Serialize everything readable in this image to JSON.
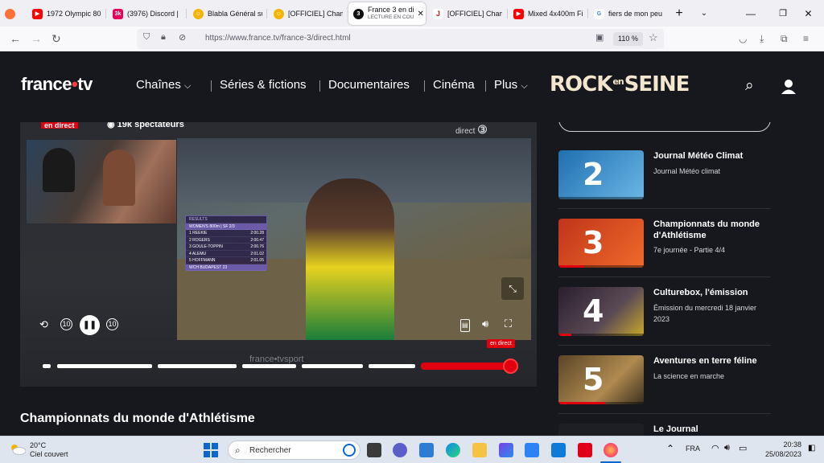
{
  "browser": {
    "tabs": [
      {
        "label": "1972 Olympic 80",
        "icon": "youtube-icon",
        "color": "#ff0000"
      },
      {
        "label": "(3976) Discord |",
        "icon": "twitch-icon",
        "color": "#e8005a"
      },
      {
        "label": "Blabla Général su",
        "icon": "forum-icon",
        "color": "#f5b400"
      },
      {
        "label": "[OFFICIEL] Cham",
        "icon": "forum-icon",
        "color": "#f5b400"
      },
      {
        "label": "France 3 en di",
        "sub": "LECTURE EN COU",
        "icon": "france3-icon",
        "color": "#111111"
      },
      {
        "label": "[OFFICIEL] Cham",
        "icon": "jv-icon",
        "color": "#d6201f"
      },
      {
        "label": "Mixed 4x400m Fi",
        "icon": "youtube-icon",
        "color": "#ff0000"
      },
      {
        "label": "fiers de mon peu",
        "icon": "google-icon",
        "color": "#4285f4"
      }
    ],
    "url": "https://www.france.tv/france-3/direct.html",
    "zoom": "110 %"
  },
  "site": {
    "logo_text": "france",
    "logo_dot": "•",
    "logo_tv": "tv",
    "menu": [
      "Chaînes",
      "Séries & fictions",
      "Documentaires",
      "Cinéma",
      "Plus"
    ],
    "partner_a": "ROCK",
    "partner_b": "en",
    "partner_c": "SEINE",
    "accent": "#e1000f"
  },
  "player": {
    "live_badge": "en direct",
    "spectators": "19k spectateurs",
    "channel_mark": "direct",
    "watermark": "france•tvsport",
    "live_tag": "en direct",
    "results": {
      "header": "RESULTS",
      "event": "WOMEN'S 800m | SF 2/3",
      "rows": [
        {
          "pos": "1",
          "name": "REEKIE",
          "time": "2:00.28"
        },
        {
          "pos": "2",
          "name": "ROGERS",
          "time": "2:00.47"
        },
        {
          "pos": "3",
          "name": "GOULE-TOPPIN",
          "time": "2:00.76"
        },
        {
          "pos": "4",
          "name": "ALEMU",
          "time": "2:01.02"
        },
        {
          "pos": "5",
          "name": "HOFFMANN",
          "time": "2:01.05"
        }
      ],
      "footer": "WCH BUDAPEST 23"
    },
    "skip_back": "10",
    "skip_fwd": "10"
  },
  "program_title": "Championnats du monde d'Athlétisme",
  "sidebar": {
    "cards": [
      {
        "channel": "2",
        "title": "Journal Météo Climat",
        "subtitle": "Journal Météo climat",
        "progress": 0,
        "bg": "#2a7fbf"
      },
      {
        "channel": "3",
        "title": "Championnats du monde d'Athlétisme",
        "subtitle": "7e journée - Partie 4/4",
        "progress": 0.3,
        "bg": "#d6401f"
      },
      {
        "channel": "4",
        "title": "Culturebox, l'émission",
        "subtitle": "Émission du mercredi 18 janvier 2023",
        "progress": 0.15,
        "bg": "#3a2c3c"
      },
      {
        "channel": "5",
        "title": "Aventures en terre féline",
        "subtitle": "La science en marche",
        "progress": 0.55,
        "bg": "#8a6a3a"
      },
      {
        "channel": "",
        "title": "Le Journal",
        "subtitle": "",
        "progress": 0,
        "bg": "#1e1f24"
      }
    ]
  },
  "taskbar": {
    "temp": "20°C",
    "weather": "Ciel couvert",
    "search_placeholder": "Rechercher",
    "lang": "FRA",
    "time": "20:38",
    "date": "25/08/2023"
  }
}
